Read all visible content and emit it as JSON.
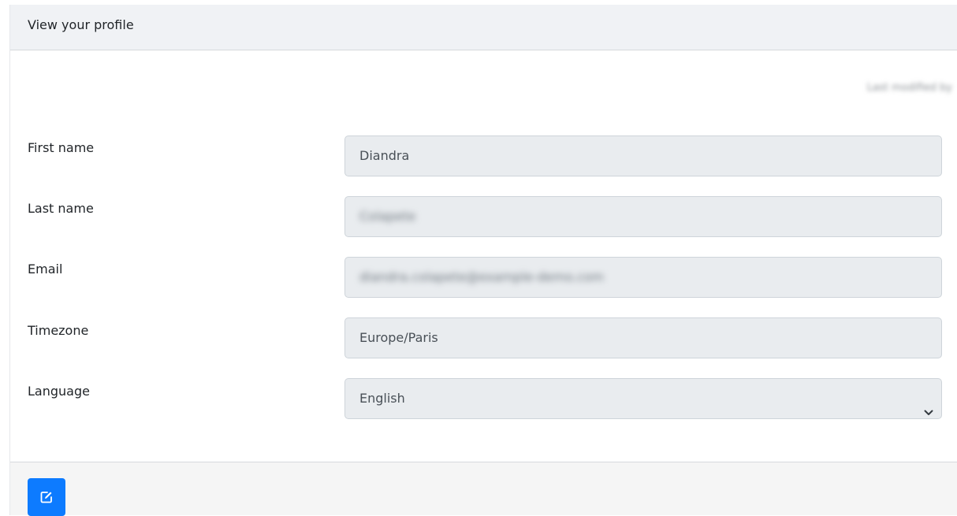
{
  "header": {
    "title": "View your profile",
    "last_modified_label": "Last modified by"
  },
  "form": {
    "first_name": {
      "label": "First name",
      "value": "Diandra"
    },
    "last_name": {
      "label": "Last name",
      "value": "Colapete"
    },
    "email": {
      "label": "Email",
      "value": "diandra.colapete@example-demo.com"
    },
    "timezone": {
      "label": "Timezone",
      "value": "Europe/Paris"
    },
    "language": {
      "label": "Language",
      "value": "English"
    }
  },
  "footer": {
    "edit_icon": "edit-icon"
  },
  "colors": {
    "accent": "#0d7bff",
    "header_bg": "#f0f2f5",
    "field_bg": "#e9ecef"
  }
}
